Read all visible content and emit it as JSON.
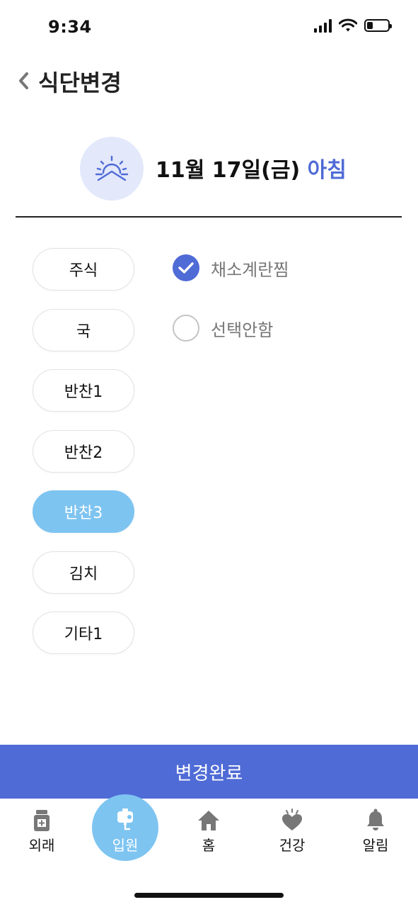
{
  "status_bar": {
    "time": "9:34"
  },
  "header": {
    "title": "식단변경"
  },
  "meal": {
    "date": "11월 17일(금)",
    "type": "아침"
  },
  "categories": [
    {
      "label": "주식",
      "active": false
    },
    {
      "label": "국",
      "active": false
    },
    {
      "label": "반찬1",
      "active": false
    },
    {
      "label": "반찬2",
      "active": false
    },
    {
      "label": "반찬3",
      "active": true
    },
    {
      "label": "김치",
      "active": false
    },
    {
      "label": "기타1",
      "active": false
    }
  ],
  "options": [
    {
      "label": "채소계란찜",
      "checked": true
    },
    {
      "label": "선택안함",
      "checked": false
    }
  ],
  "complete_button": "변경완료",
  "tabs": [
    {
      "label": "외래",
      "icon": "medicine-bottle-icon"
    },
    {
      "label": "입원",
      "icon": "iv-bag-icon",
      "active": true
    },
    {
      "label": "홈",
      "icon": "home-icon"
    },
    {
      "label": "건강",
      "icon": "heart-icon"
    },
    {
      "label": "알림",
      "icon": "bell-icon"
    }
  ],
  "colors": {
    "primary": "#4f6bd6",
    "active_pill": "#7ec4f1",
    "meal_icon_bg": "#e3e8fb"
  }
}
